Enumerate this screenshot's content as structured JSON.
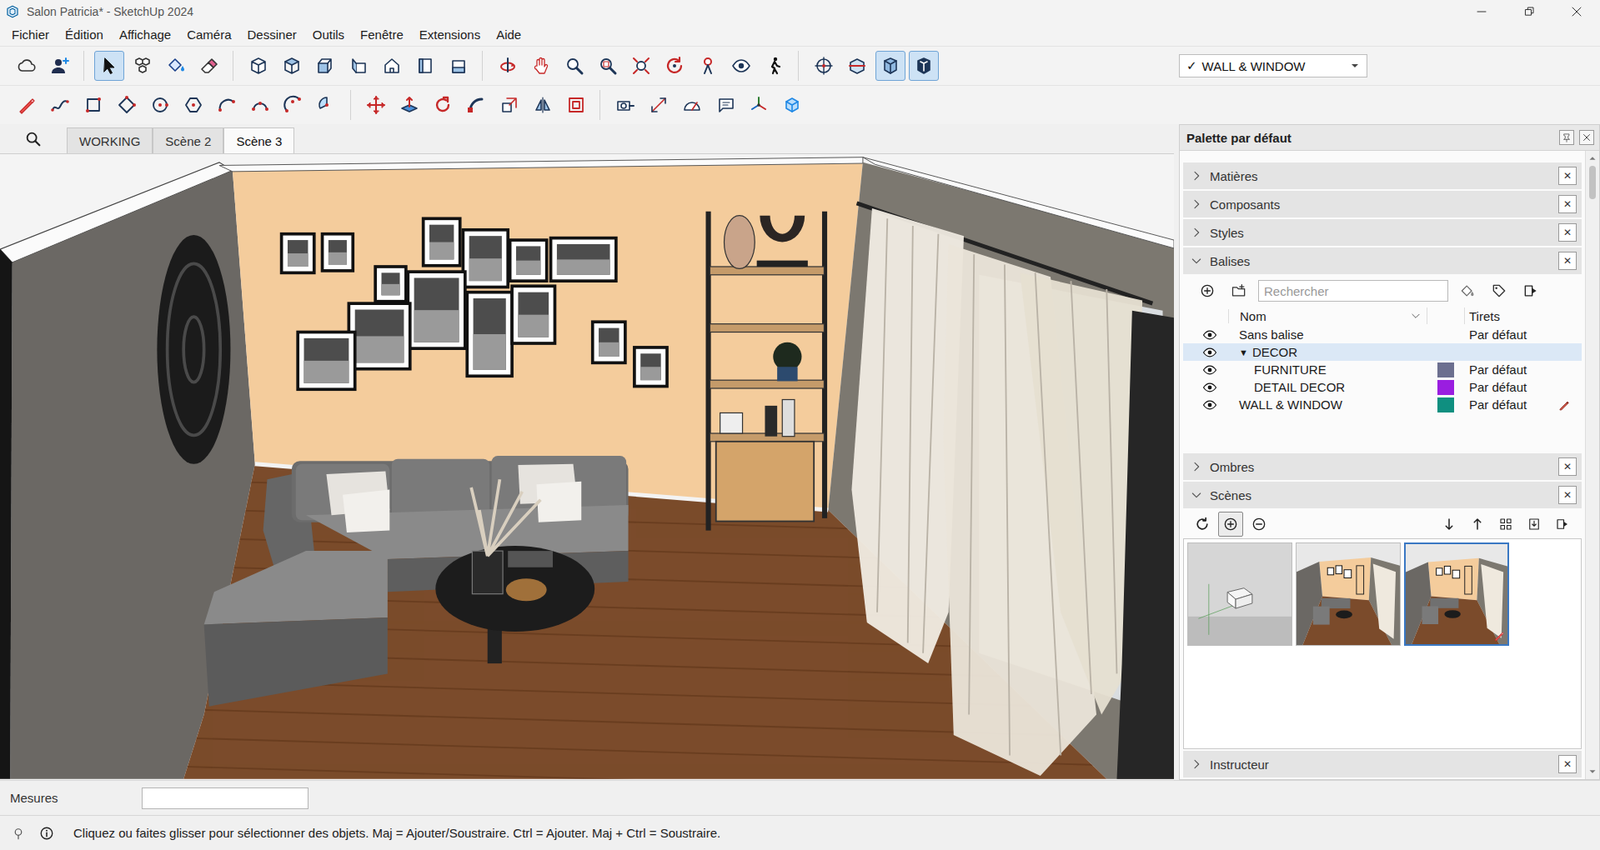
{
  "window": {
    "title": "Salon Patricia* - SketchUp 2024"
  },
  "menu": [
    "Fichier",
    "Édition",
    "Affichage",
    "Caméra",
    "Dessiner",
    "Outils",
    "Fenêtre",
    "Extensions",
    "Aide"
  ],
  "toolbars": [
    [
      [
        {
          "pressed": false
        },
        {
          "pressed": false
        }
      ],
      [
        {
          "pressed": true
        },
        {
          "pressed": false
        },
        {
          "pressed": false
        },
        {
          "pressed": false
        }
      ],
      [
        {
          "pressed": false
        },
        {
          "pressed": false
        },
        {
          "pressed": false
        },
        {
          "pressed": false
        },
        {
          "pressed": false
        },
        {
          "pressed": false
        },
        {
          "pressed": false
        }
      ],
      [
        {
          "pressed": false
        },
        {
          "pressed": false
        },
        {
          "pressed": false
        },
        {
          "pressed": false
        },
        {
          "pressed": false
        },
        {
          "pressed": false
        },
        {
          "pressed": false
        },
        {
          "pressed": false
        },
        {
          "pressed": false
        }
      ],
      [
        {
          "pressed": false
        },
        {
          "pressed": false
        },
        {
          "pressed": true
        },
        {
          "pressed": true
        }
      ]
    ],
    [
      [
        {
          "pressed": false
        },
        {
          "pressed": false
        },
        {
          "pressed": false
        },
        {
          "pressed": false
        },
        {
          "pressed": false
        },
        {
          "pressed": false
        },
        {
          "pressed": false
        },
        {
          "pressed": false
        },
        {
          "pressed": false
        },
        {
          "pressed": false
        }
      ],
      [
        {
          "pressed": false
        },
        {
          "pressed": false
        },
        {
          "pressed": false
        },
        {
          "pressed": false
        },
        {
          "pressed": false
        },
        {
          "pressed": false
        },
        {
          "pressed": false
        }
      ],
      [
        {
          "pressed": false
        },
        {
          "pressed": false
        },
        {
          "pressed": false
        },
        {
          "pressed": false
        },
        {
          "pressed": false
        },
        {
          "pressed": false
        }
      ]
    ]
  ],
  "active_tag": {
    "check": "✓",
    "label": "WALL & WINDOW"
  },
  "scene_tabs": [
    {
      "label": "WORKING",
      "selected": false
    },
    {
      "label": "Scène 2",
      "selected": false
    },
    {
      "label": "Scène 3",
      "selected": true
    }
  ],
  "palette": {
    "title": "Palette par défaut",
    "close": "✕",
    "sections": [
      {
        "label": "Matières",
        "expanded": false,
        "kind": "plain"
      },
      {
        "label": "Composants",
        "expanded": false,
        "kind": "plain"
      },
      {
        "label": "Styles",
        "expanded": false,
        "kind": "plain"
      },
      {
        "label": "Balises",
        "expanded": true,
        "kind": "tags"
      },
      {
        "label": "Ombres",
        "expanded": false,
        "kind": "plain"
      },
      {
        "label": "Scènes",
        "expanded": true,
        "kind": "scenes"
      },
      {
        "label": "Instructeur",
        "expanded": false,
        "kind": "plain"
      }
    ]
  },
  "tags": {
    "search_placeholder": "Rechercher",
    "columns": [
      "Nom",
      "Tirets"
    ],
    "rows": [
      {
        "name": "Sans balise",
        "kind": "tag",
        "visible": true,
        "selected": false,
        "dashes": "Par défaut",
        "active": false
      },
      {
        "name": "DECOR",
        "kind": "folder",
        "visible": true,
        "selected": true,
        "expanded": true,
        "toggle": "▼",
        "children": [
          {
            "name": "FURNITURE",
            "kind": "tag",
            "visible": true,
            "selected": false,
            "color": "#6c6f8f",
            "dashes": "Par défaut",
            "active": false
          },
          {
            "name": "DETAIL DECOR",
            "kind": "tag",
            "visible": true,
            "selected": false,
            "color": "#9a1ee0",
            "dashes": "Par défaut",
            "active": false
          }
        ]
      },
      {
        "name": "WALL & WINDOW",
        "kind": "tag",
        "visible": true,
        "selected": false,
        "color": "#0f8f80",
        "dashes": "Par défaut",
        "active": true
      }
    ]
  },
  "scenes": {
    "add_pressed": true,
    "thumbnails": [
      {
        "kind": "blank",
        "selected": false,
        "modified": false
      },
      {
        "kind": "room",
        "selected": false,
        "modified": false
      },
      {
        "kind": "room",
        "selected": true,
        "modified": true
      }
    ]
  },
  "measurements": {
    "label": "Mesures",
    "value": ""
  },
  "status_bar": {
    "text": "Cliquez ou faites glisser pour sélectionner des objets. Maj = Ajouter/Soustraire. Ctrl = Ajouter. Maj + Ctrl = Soustraire."
  }
}
